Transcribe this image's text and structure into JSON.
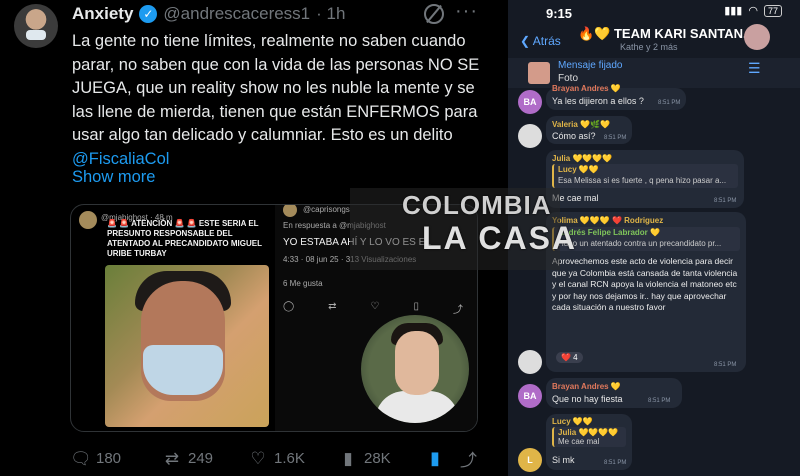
{
  "tweet": {
    "name": "Anxiety",
    "handle": "@andrescaceress1",
    "time": "· 1h",
    "text": "La gente no tiene límites, realmente no saben cuando parar, no saben que con la vida de las personas NO SE JUEGA, que un reality show no les nuble la mente y se las llene de mierda, tienen que están ENFERMOS para usar algo tan delicado y calumniar.  Esto es un delito ",
    "mention": "@FiscaliaCol",
    "show_more": "Show more",
    "actions": {
      "replies": "180",
      "reposts": "249",
      "likes": "1.6K",
      "views": "28K"
    }
  },
  "media_left": {
    "handle": "@mjabighost · 48 m",
    "caption": "🚨 🚨 ATENCIÓN 🚨 🚨 ESTE SERIA EL PRESUNTO RESPONSABLE DEL ATENTADO AL PRECANDIDATO MIGUEL URIBE TURBAY"
  },
  "media_right": {
    "handle": "@caprisongs",
    "reply_to": "En respuesta a @mjabighost",
    "text": "YO ESTABA AHÍ Y LO VO ES EL",
    "meta": "4:33 · 08 jun 25 · 313 Visualizaciones",
    "likes": "6 Me gusta"
  },
  "watermark": {
    "line1": "COLOMBIA",
    "line2": "LA CASA"
  },
  "phone": {
    "status_time": "9:15",
    "battery": "77",
    "back": "Atrás",
    "title": "🔥💛 TEAM KARI SANTAN...",
    "subtitle": "Kathe y 2 más",
    "pinned_title": "Mensaje fijado",
    "pinned_text": "Foto",
    "messages": [
      {
        "avatar": "BA",
        "user": "Brayan Andres 💛",
        "text": "Ya les dijieron a ellos ?",
        "time": "8:51 PM"
      },
      {
        "user": "Valeria 💛🌿💛",
        "text": "Cómo así?",
        "time": "8:51 PM"
      },
      {
        "user": "Julia 💛💛💛💛",
        "quote_user": "Lucy 💛💛",
        "quote_text": "Esa Melissa si es fuerte , q pena hizo pasar a...",
        "text": "Me cae mal",
        "time": "8:51 PM"
      },
      {
        "user": "Yolima 💛💛💛 ❤️ Rodriguez",
        "quote_user": "Andrés Felipe Labrador 💛",
        "quote_text": "Hubo un atentado contra un precandidato pr...",
        "text": "Aprovechemos este acto de violencia para decir que ya Colombia está cansada de tanta violencia y el canal RCN apoya la violencia el matoneo etc y por hay nos dejamos ir.. hay que aprovechar cada situación a nuestro favor",
        "reaction": "❤️ 4",
        "time": "8:51 PM"
      },
      {
        "avatar": "BA",
        "user": "Brayan Andres 💛",
        "text": "Que no hay fiesta",
        "time": "8:51 PM"
      },
      {
        "avatar": "L",
        "user": "Lucy 💛💛",
        "quote_user": "Julia 💛💛💛💛",
        "quote_text": "Me cae mal",
        "text": "Si mk",
        "time": "8:51 PM"
      }
    ]
  },
  "colors": {
    "link": "#1d9bf0",
    "telegram_blue": "#5fa8ff",
    "accent_yellow": "#e0b548"
  }
}
